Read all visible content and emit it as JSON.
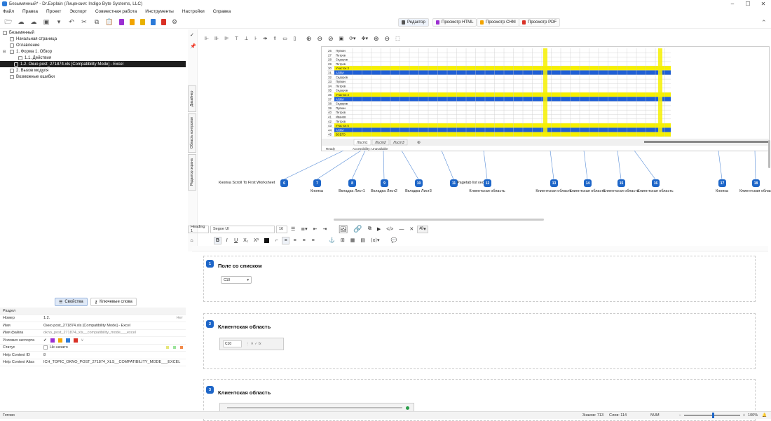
{
  "window": {
    "title": "Безымянный* - Dr.Explain (Лицензия: Indigo Byte Systems, LLC)"
  },
  "menu": [
    "Файл",
    "Правка",
    "Проект",
    "Экспорт",
    "Совместная работа",
    "Инструменты",
    "Настройки",
    "Справка"
  ],
  "view_buttons": [
    "Редактор",
    "Просмотр HTML",
    "Просмотр CHM",
    "Просмотр PDF"
  ],
  "tree": [
    {
      "label": "Безымянный",
      "indent": 0
    },
    {
      "label": "Начальная страница",
      "indent": 1
    },
    {
      "label": "Оглавление",
      "indent": 1
    },
    {
      "label": "1. Форма 1. Обзор",
      "indent": 1
    },
    {
      "label": "1.1. Действия",
      "indent": 2
    },
    {
      "label": "1.2. Окно post_271874.xls [Compatibility Mode] - Excel",
      "indent": 2,
      "selected": true
    },
    {
      "label": "2. Вызов модуля",
      "indent": 1
    },
    {
      "label": "Возможные ошибки",
      "indent": 1
    }
  ],
  "prop_tabs": [
    "Свойства",
    "Ключевые слова"
  ],
  "props": {
    "section": "Раздел",
    "rows": [
      {
        "k": "Номер",
        "v": "1.2.",
        "extra": "Нет"
      },
      {
        "k": "Имя",
        "v": "Окно post_271874.xls [Compatibility Mode] - Excel"
      },
      {
        "k": "Имя файла",
        "v": "okno_post_271874_xls__compatibility_mode___excel"
      },
      {
        "k": "Условия экспорта",
        "v": ""
      },
      {
        "k": "Статус",
        "v": "Не начато"
      },
      {
        "k": "Help Context ID",
        "v": "8"
      },
      {
        "k": "Help Context Alias",
        "v": "ICH_TOPIC_OKNO_POST_271874_XLS__COMPATIBILITY_MODE___EXCEL"
      }
    ]
  },
  "side_tabs": [
    "Дизайнер",
    "Область контролов",
    "Редактор экрана"
  ],
  "screenshot": {
    "rows": [
      "26",
      "27",
      "28",
      "29",
      "30",
      "31",
      "32",
      "33",
      "34",
      "35",
      "36",
      "37",
      "38",
      "39",
      "40",
      "41",
      "42",
      "43",
      "44",
      "45"
    ],
    "names": [
      "Пупкин",
      "Петров",
      "Сидоров",
      "Петров",
      "Участок 3",
      "АЛЛИ",
      "Сидоров",
      "Пупкин",
      "Петров",
      "Сидоров",
      "Участок 4",
      "АЛЛИ",
      "Сидоров",
      "Пупкин",
      "Петров",
      "Иванов",
      "Петров",
      "Участок 5",
      "АЛЛИ",
      "ВСЕГО"
    ],
    "sheets": [
      "Лист1",
      "Лист2",
      "Лист3"
    ],
    "ready": "Ready",
    "accessibility": "Accessibility: Unavailable"
  },
  "callouts": [
    {
      "n": "6",
      "label": "Кнопка Scroll To First Worksheet"
    },
    {
      "n": "7",
      "label": "Кнопка"
    },
    {
      "n": "8",
      "label": "Вкладка Лист1"
    },
    {
      "n": "9",
      "label": "Вкладка Лист2"
    },
    {
      "n": "10",
      "label": "Вкладка Лист3"
    },
    {
      "n": "11",
      "label": "Pagetab list кнопки"
    },
    {
      "n": "12",
      "label": "Клиентская область"
    },
    {
      "n": "13",
      "label": "Клиентская область"
    },
    {
      "n": "14",
      "label": "Клиентская область"
    },
    {
      "n": "15",
      "label": "Клиентская область"
    },
    {
      "n": "16",
      "label": "Клиентская область"
    },
    {
      "n": "17",
      "label": "Кнопка"
    },
    {
      "n": "18",
      "label": "Клиентская облас"
    }
  ],
  "editor_toolbar": {
    "style": "Heading 1",
    "font": "Segoe UI",
    "size": "16"
  },
  "sections": [
    {
      "n": "1",
      "title": "Поле со списком",
      "combo": "C10"
    },
    {
      "n": "2",
      "title": "Клиентская область",
      "combo": "C10"
    },
    {
      "n": "3",
      "title": "Клиентская область"
    }
  ],
  "status": {
    "left": "Готово",
    "chars": "Знаков: 713",
    "words": "Слов: 114",
    "num": "NUM",
    "zoom": "100%"
  },
  "colors": {
    "accent": "#1e66c8",
    "select": "#1e1e1e",
    "highlight_yellow": "#f6f000",
    "band_blue": "#1f5fd6"
  }
}
